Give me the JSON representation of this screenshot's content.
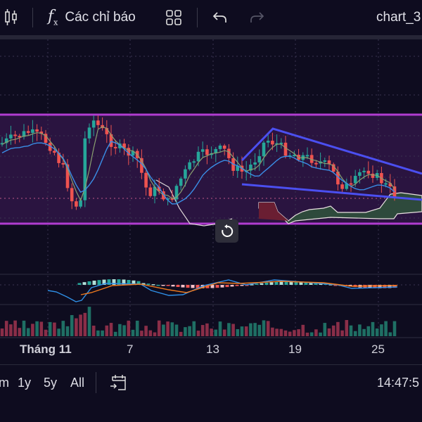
{
  "toolbar": {
    "chart_type_icon": "candlestick-icon",
    "indicators_label": "Các chỉ báo",
    "indicators_icon": "function-fx-icon",
    "layout_icon": "grid-layout-icon",
    "undo_icon": "undo-icon",
    "redo_icon": "redo-icon",
    "chart_name": "chart_3"
  },
  "time_axis": {
    "labels": [
      "Tháng 11",
      "7",
      "13",
      "19",
      "25"
    ]
  },
  "bottom_bar": {
    "ranges": [
      "m",
      "1y",
      "5y",
      "All"
    ],
    "goto_date_icon": "calendar-goto-icon",
    "clock": "14:47:5"
  },
  "colors": {
    "background": "#0e0c1f",
    "up": "#26a69a",
    "down": "#ef5350",
    "channel": "#b03cd0",
    "channel_fill": "#2a1440",
    "wedge": "#4b4ff0",
    "macd": "#2f8fe6",
    "signal": "#f07a1e"
  },
  "reset_icon": "reset-chart-icon"
}
